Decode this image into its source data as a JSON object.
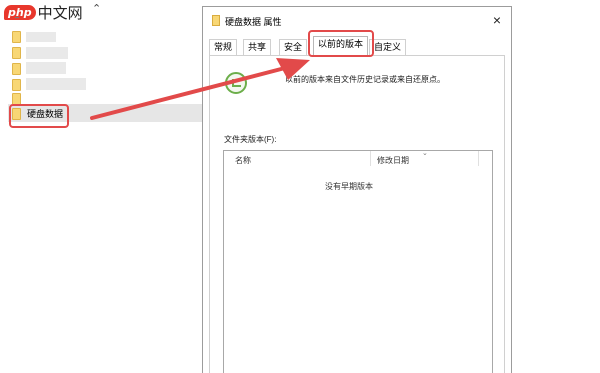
{
  "watermark": {
    "badge": "php",
    "text": "中文网"
  },
  "explorer": {
    "up_arrow_icon": "chevron-up-icon",
    "selected_item_label": "硬盘数据"
  },
  "dialog": {
    "title": "硬盘数据 属性",
    "close_label": "×",
    "tabs": [
      {
        "label": "常规"
      },
      {
        "label": "共享"
      },
      {
        "label": "安全"
      },
      {
        "label": "以前的版本"
      },
      {
        "label": "自定义"
      }
    ],
    "active_tab": "以前的版本",
    "description": "以前的版本来自文件历史记录或来自还原点。",
    "folder_versions_label": "文件夹版本(F):",
    "columns": {
      "name": "名称",
      "modified": "修改日期"
    },
    "empty_message": "没有早期版本"
  },
  "colors": {
    "annotation": "#e24a4a",
    "folder": "#f8d775"
  }
}
